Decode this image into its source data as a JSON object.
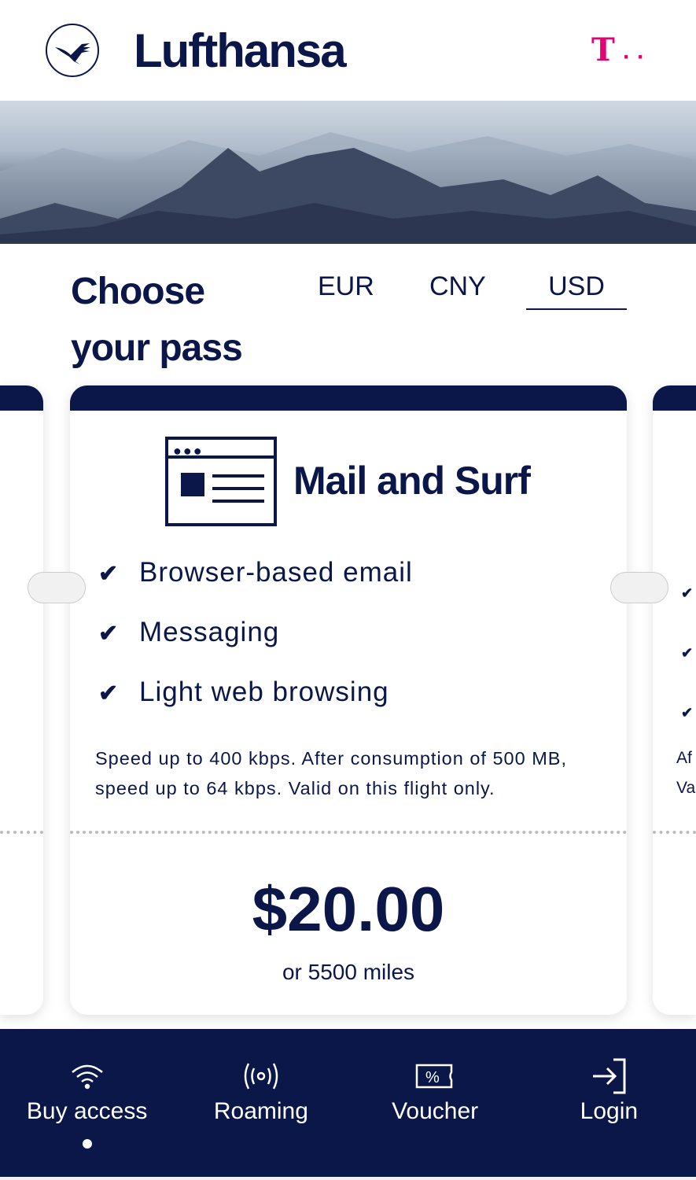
{
  "header": {
    "brand": "Lufthansa",
    "provider_logo": "T"
  },
  "page": {
    "title_line1": "Choose",
    "title_line2": "your pass"
  },
  "currencies": [
    {
      "label": "EUR",
      "active": false
    },
    {
      "label": "CNY",
      "active": false
    },
    {
      "label": "USD",
      "active": true
    }
  ],
  "card": {
    "name": "Mail and Surf",
    "icon": "browser-window-icon",
    "features": [
      "Browser-based email",
      "Messaging",
      "Light web browsing"
    ],
    "description": "Speed up to 400 kbps. After consumption of 500 MB, speed up to 64 kbps. Valid on this flight only.",
    "price": "$20.00",
    "miles": "or 5500 miles"
  },
  "next_card": {
    "desc_line1": "Af",
    "desc_line2": "Va"
  },
  "nav": [
    {
      "label": "Buy access",
      "icon": "wifi-icon",
      "active": true
    },
    {
      "label": "Roaming",
      "icon": "roaming-icon",
      "active": false
    },
    {
      "label": "Voucher",
      "icon": "voucher-icon",
      "active": false
    },
    {
      "label": "Login",
      "icon": "login-icon",
      "active": false
    }
  ],
  "colors": {
    "navy": "#0b1649",
    "magenta": "#e20074"
  }
}
